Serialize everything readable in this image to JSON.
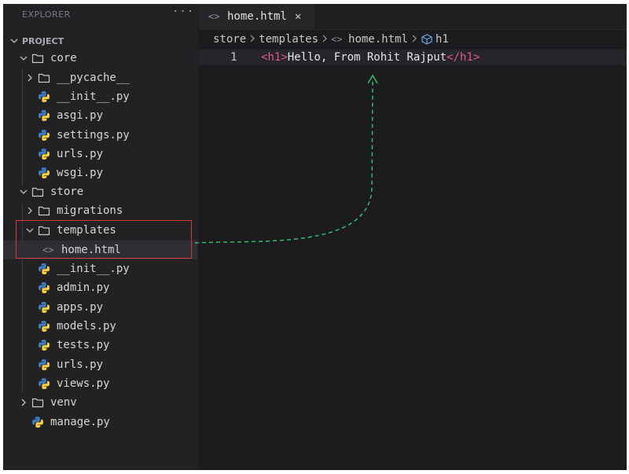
{
  "explorer": {
    "title": "EXPLORER",
    "more": "···",
    "project_label": "PROJECT",
    "tree": [
      {
        "name": "core",
        "kind": "folder-open"
      },
      {
        "name": "__pycache__",
        "kind": "folder-closed"
      },
      {
        "name": "__init__.py",
        "kind": "python"
      },
      {
        "name": "asgi.py",
        "kind": "python"
      },
      {
        "name": "settings.py",
        "kind": "python"
      },
      {
        "name": "urls.py",
        "kind": "python"
      },
      {
        "name": "wsgi.py",
        "kind": "python"
      },
      {
        "name": "store",
        "kind": "folder-open"
      },
      {
        "name": "migrations",
        "kind": "folder-closed"
      },
      {
        "name": "templates",
        "kind": "folder-open"
      },
      {
        "name": "home.html",
        "kind": "html"
      },
      {
        "name": "__init__.py",
        "kind": "python"
      },
      {
        "name": "admin.py",
        "kind": "python"
      },
      {
        "name": "apps.py",
        "kind": "python"
      },
      {
        "name": "models.py",
        "kind": "python"
      },
      {
        "name": "tests.py",
        "kind": "python"
      },
      {
        "name": "urls.py",
        "kind": "python"
      },
      {
        "name": "views.py",
        "kind": "python"
      },
      {
        "name": "venv",
        "kind": "folder-closed"
      },
      {
        "name": "manage.py",
        "kind": "python"
      }
    ]
  },
  "editor": {
    "tab_label": "home.html",
    "tab_close": "✕",
    "breadcrumb": [
      "store",
      "templates",
      "home.html",
      "h1"
    ],
    "line_number": "1",
    "code": {
      "open_tag": "<h1>",
      "text": "Hello, From Rohit Rajput",
      "close_tag": "</h1>"
    }
  },
  "colors": {
    "accent_tag": "#e2568c",
    "highlight_box": "#d6363d",
    "arrow": "#2fbf71"
  }
}
